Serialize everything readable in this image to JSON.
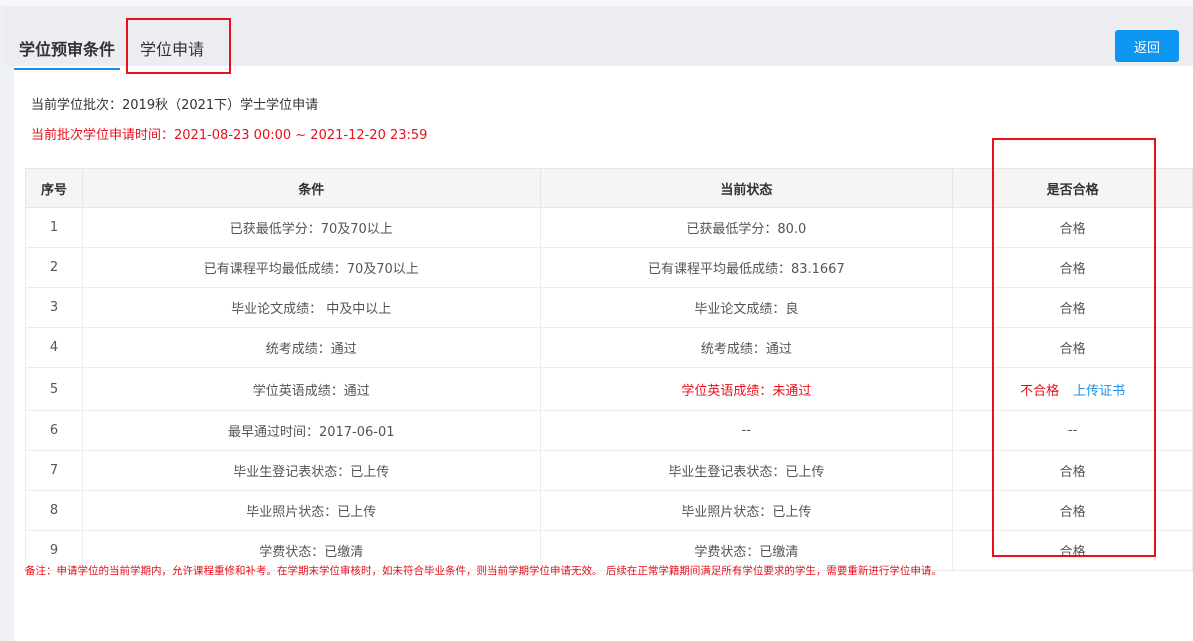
{
  "tabs": [
    "学位预审条件",
    "学位申请"
  ],
  "back_label": "返回",
  "batch": "当前学位批次：2019秋（2021下）学士学位申请",
  "time": "当前批次学位申请时间：2021-08-23 00:00 ~ 2021-12-20 23:59",
  "columns": [
    "序号",
    "条件",
    "当前状态",
    "是否合格"
  ],
  "rows": [
    [
      "1",
      "已获最低学分：70及70以上",
      "已获最低学分：80.0",
      "合格"
    ],
    [
      "2",
      "已有课程平均最低成绩：70及70以上",
      "已有课程平均最低成绩：83.1667",
      "合格"
    ],
    [
      "3",
      "毕业论文成绩： 中及中以上",
      "毕业论文成绩：良",
      "合格"
    ],
    [
      "4",
      "统考成绩：通过",
      "统考成绩：通过",
      "合格"
    ],
    [
      "5",
      "学位英语成绩：通过",
      "学位英语成绩：未通过",
      "不合格"
    ],
    [
      "6",
      "最早通过时间：2017-06-01",
      "--",
      "--"
    ],
    [
      "7",
      "毕业生登记表状态：已上传",
      "毕业生登记表状态：已上传",
      "合格"
    ],
    [
      "8",
      "毕业照片状态：已上传",
      "毕业照片状态：已上传",
      "合格"
    ],
    [
      "9",
      "学费状态：已缴清",
      "学费状态：已缴清",
      "合格"
    ]
  ],
  "upload_link": "上传证书",
  "note": "备注：申请学位的当前学期内，允许课程重修和补考。在学期末学位审核时，如未符合毕业条件，则当前学期学位申请无效。 后续在正常学籍期间满足所有学位要求的学生，需要重新进行学位申请。"
}
